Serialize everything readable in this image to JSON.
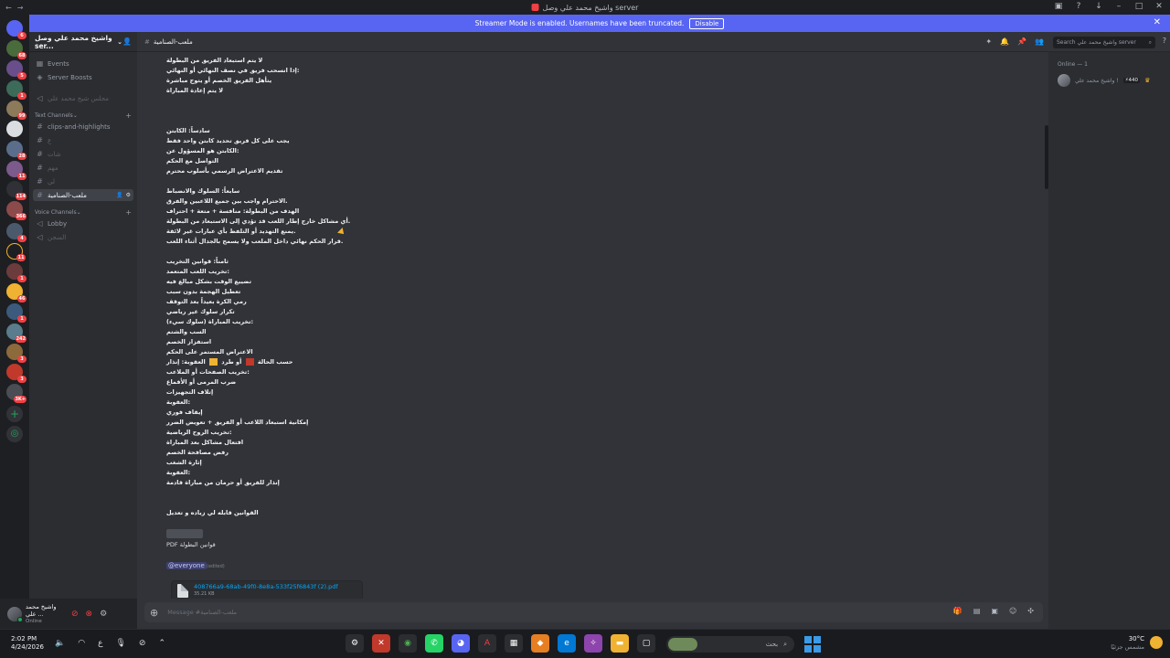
{
  "window": {
    "title": "واشيخ محمد علي وصل server"
  },
  "banner": {
    "text": "Streamer Mode is enabled. Usernames have been truncated.",
    "disable_label": "Disable"
  },
  "server_badges": [
    "6",
    "68",
    "5",
    "1",
    "99",
    "28",
    "11",
    "114",
    "366",
    "4",
    "11",
    "1",
    "46",
    "1",
    "242",
    "3",
    "3",
    "3K+"
  ],
  "sidebar": {
    "guild_name": "واشيخ محمد علي وصل ser...",
    "items": {
      "events": "Events",
      "boosts": "Server Boosts",
      "council": "مجلس شيخ محمد علي",
      "text_category": "Text Channels",
      "clips": "clips-and-highlights",
      "ch1": "ع",
      "ch2": "شات",
      "ch3": "مهم",
      "ch4": "لي",
      "active": "ملعب-الصنامية",
      "voice_category": "Voice Channels",
      "lobby": "Lobby",
      "prison": "السجن"
    }
  },
  "user_panel": {
    "name": "واشيخ محمد علي ...",
    "status": "Online"
  },
  "header": {
    "channel": "ملعب-الصنامية",
    "search_placeholder": "Search واشيخ محمد علي server"
  },
  "chat": {
    "lines": [
      "لا يتم استبعاد الفريق من البطولة",
      "إذا انسحب فريق في نصف النهائي أو النهائي:",
      "يتأهل الفريق الخصم أو يتوج مباشرة",
      "لا يتم إعادة المباراة",
      "سادساً: الكابتن",
      "يجب على كل فريق تحديد كابتن واحد فقط",
      "الكابتن هو المسؤول عن:",
      "التواصل مع الحكم",
      "تقديم الاعتراض الرسمي بأسلوب محترم",
      "سابعاً: السلوك والانضباط",
      "الاحترام واجب بين جميع اللاعبين والفرق.",
      "الهدف من البطولة: منافسة + متعة + احتراف",
      "أي مشاكل خارج إطار اللعب قد تؤدي إلى الاستبعاد من البطولة.",
      "يمنع التهديد أو التلفظ بأي عبارات غير لائقة.",
      "قرار الحكم نهائي داخل الملعب ولا يسمح بالجدال أثناء اللعب.",
      "ثامناً: قوانين التخريب",
      "تخريب اللعب المتعمد:",
      "تضييع الوقت بشكل مبالغ فيه",
      "تعطيل الهجمة بدون سبب",
      "رمي الكرة بعيداً بعد التوقف",
      "تكرار سلوك غير رياضي",
      "تخريب المباراة (سلوك سيء):",
      "السب والشتم",
      "استفزاز الخصم",
      "الاعتراض المستمر على الحكم",
      "العقوبة: إنذار",
      "أو طرد",
      "حسب الحالة",
      "تخريب الصفحات أو الملاعب:",
      "ضرب المرمى أو الأقماع",
      "إتلاف التجهيزات",
      "العقوبة:",
      "إيقاف فوري",
      "إمكانية استبعاد اللاعب أو الفريق + تعويض الضرر",
      "تخريب الروح الرياضية:",
      "افتعال مشاكل بعد المباراة",
      "رفض مصافحة الخصم",
      "إثارة الشغب",
      "العقوبة:",
      "إنذار للفريق أو حرمان من مباراة قادمة",
      "القوانين قابله لي زياده و تعديل",
      "قوانين البطولة",
      "PDF"
    ],
    "mention": "@everyone",
    "mention_note": "(edited)",
    "attachment": {
      "name": "408766a9-68ab-49f0-8e8a-533f25f6843f (2).pdf",
      "size": "35.21 KB"
    },
    "composer_placeholder": "Message #ملعب-الصنامية"
  },
  "members": {
    "heading": "Online — 1",
    "member_name": "واشيخ محمد علي !",
    "member_tag": "⚡440"
  },
  "taskbar": {
    "time": "2:02 PM",
    "date": "4/24/2026",
    "lang": "ع",
    "search": "بحث",
    "temp": "30°C",
    "weather": "مشمس جزئيًا"
  },
  "colors": {
    "blurple": "#5865f2",
    "background": "#313338",
    "sidebar": "#2b2d31",
    "rail": "#1e1f22",
    "red": "#f23f43",
    "yellow": "#f0b232"
  }
}
